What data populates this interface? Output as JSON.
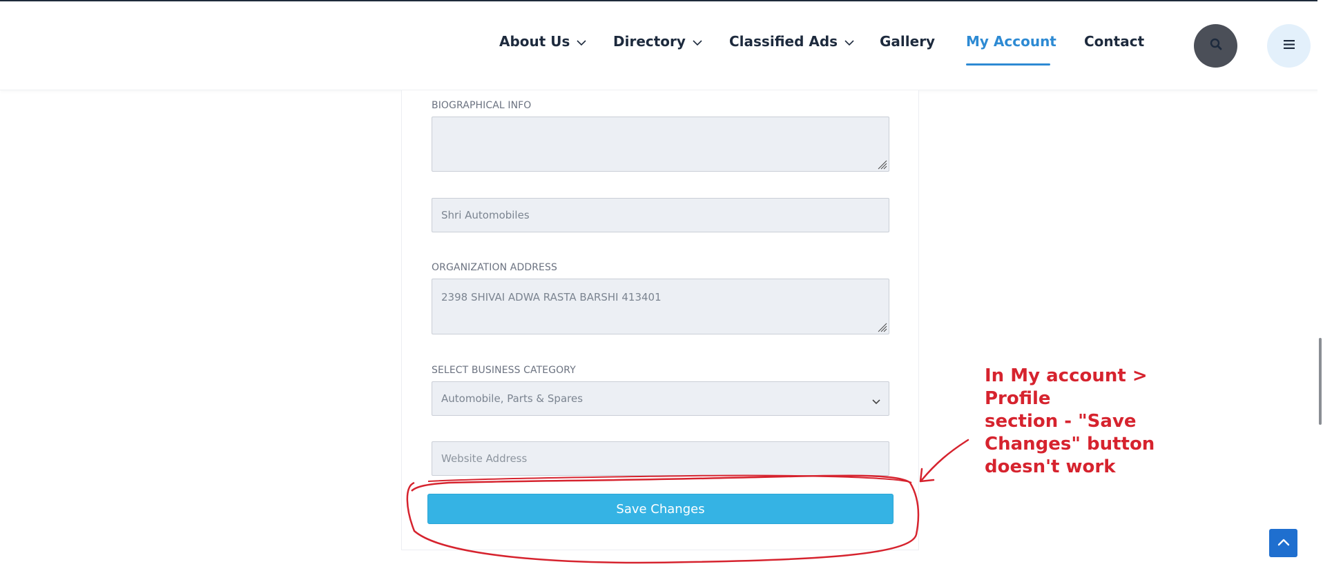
{
  "nav": {
    "items": [
      {
        "label": "About Us",
        "has_dropdown": true
      },
      {
        "label": "Directory",
        "has_dropdown": true
      },
      {
        "label": "Classified Ads",
        "has_dropdown": true
      },
      {
        "label": "Gallery",
        "has_dropdown": false
      },
      {
        "label": "My Account",
        "has_dropdown": false,
        "active": true
      },
      {
        "label": "Contact",
        "has_dropdown": false
      }
    ],
    "search_icon": "search-icon",
    "menu_icon": "hamburger-icon"
  },
  "form": {
    "bio_label": "BIOGRAPHICAL INFO",
    "bio_value": "",
    "organization_value": "Shri Automobiles",
    "org_address_label": "ORGANIZATION ADDRESS",
    "org_address_value": "2398 SHIVAI ADWA RASTA BARSHI 413401",
    "category_label": "SELECT BUSINESS CATEGORY",
    "category_selected": "Automobile, Parts & Spares",
    "website_placeholder": "Website Address",
    "save_label": "Save Changes"
  },
  "annotation": {
    "lines": [
      "In My account > Profile",
      "section - \"Save",
      "Changes\" button",
      "doesn't work"
    ]
  },
  "colors": {
    "nav_text": "#1d2a3d",
    "nav_active": "#2d8ad3",
    "save_button": "#35b3e4",
    "annotation_red": "#d6232e",
    "back_to_top": "#1f6fcf"
  }
}
